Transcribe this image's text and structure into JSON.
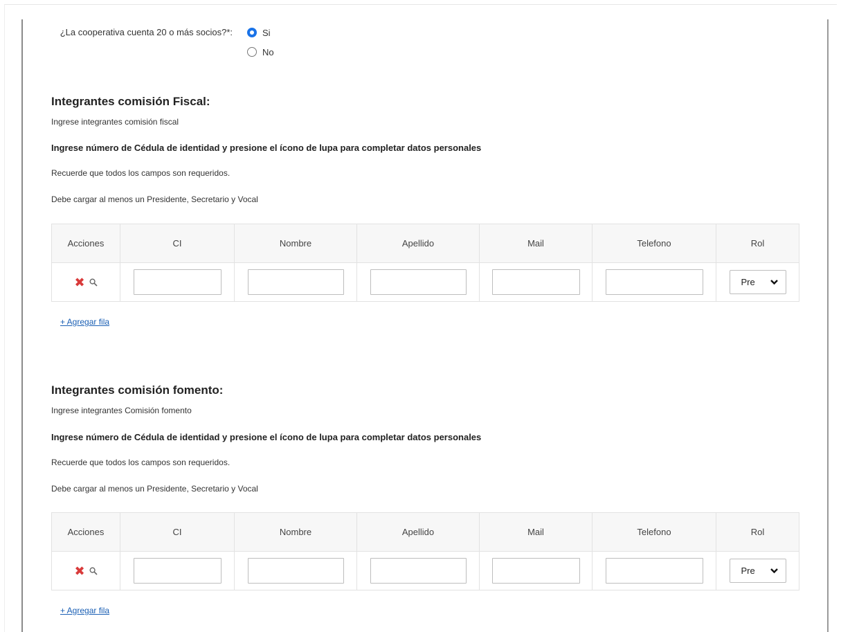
{
  "question": {
    "label": "¿La cooperativa cuenta 20 o más socios?*:",
    "options": [
      {
        "label": "Si",
        "checked": true
      },
      {
        "label": "No",
        "checked": false
      }
    ]
  },
  "fiscal": {
    "title": "Integrantes comisión Fiscal:",
    "subtitle": "Ingrese integrantes comisión fiscal",
    "instruction": "Ingrese número de Cédula de identidad y presione el ícono de lupa para completar datos personales",
    "note_required": "Recuerde que todos los campos son requeridos.",
    "note_roles": "Debe cargar al menos un Presidente, Secretario y Vocal",
    "add_row": "+ Agregar fila",
    "row": {
      "role_value": "Pre"
    }
  },
  "fomento": {
    "title": "Integrantes comisión fomento:",
    "subtitle": "Ingrese integrantes Comisión fomento",
    "instruction": "Ingrese número de Cédula de identidad y presione el ícono de lupa para completar datos personales",
    "note_required": "Recuerde que todos los campos son requeridos.",
    "note_roles": "Debe cargar al menos un Presidente, Secretario y Vocal",
    "add_row": "+ Agregar fila",
    "row": {
      "role_value": "Pre"
    }
  },
  "columns": [
    "Acciones",
    "CI",
    "Nombre",
    "Apellido",
    "Mail",
    "Telefono",
    "Rol"
  ],
  "icons": {
    "delete": "delete-icon",
    "search": "search-icon",
    "chevron": "chevron-down-icon"
  },
  "colors": {
    "delete": "#d93a3a",
    "radio_checked": "#1a73e8",
    "link": "#1a5fb4"
  }
}
